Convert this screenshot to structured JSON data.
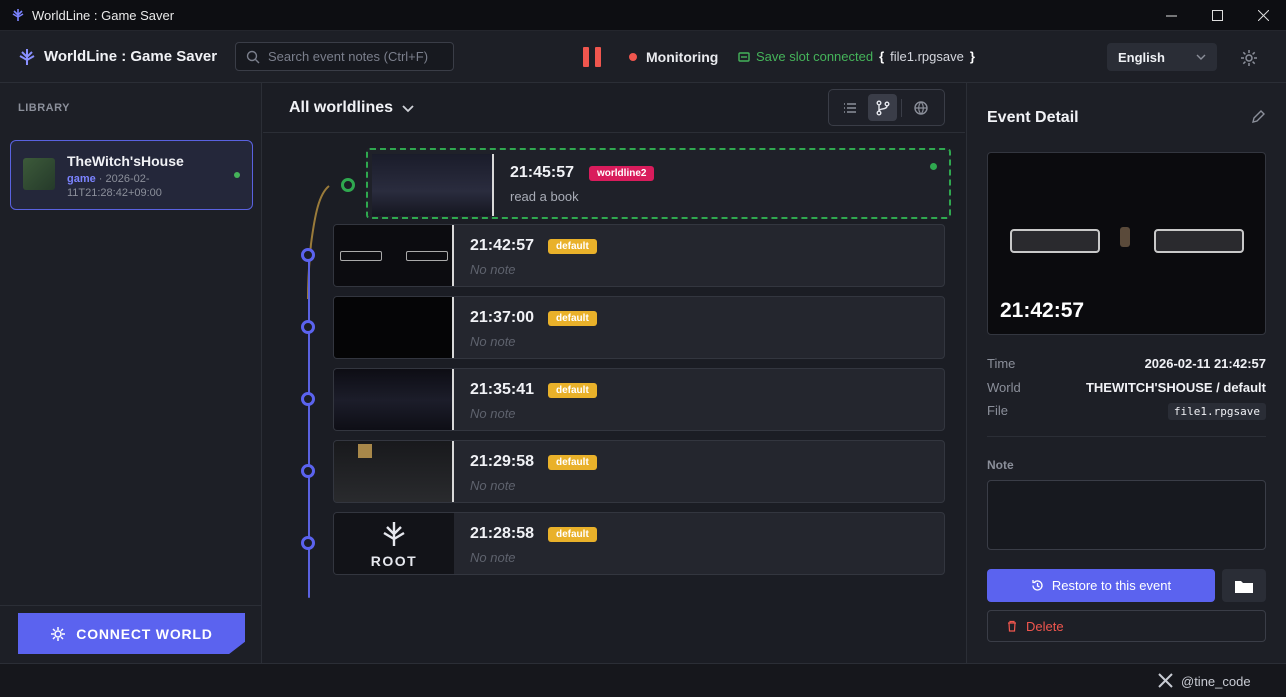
{
  "window": {
    "title": "WorldLine : Game Saver"
  },
  "header": {
    "brand": "WorldLine : Game Saver",
    "search_placeholder": "Search event notes (Ctrl+F)",
    "monitoring_label": "Monitoring",
    "slot_status": "Save slot connected",
    "slot_open": "{",
    "slot_file": "file1.rpgsave",
    "slot_close": "}",
    "language": "English"
  },
  "sidebar": {
    "title": "LIBRARY",
    "items": [
      {
        "name": "TheWitch'sHouse",
        "tag": "game",
        "date": " · 2026-02-11T21:28:42+09:00"
      }
    ],
    "connect_label": "CONNECT WORLD"
  },
  "main": {
    "worldline_selector": "All worldlines",
    "events": [
      {
        "time": "21:45:57",
        "badge": "worldline2",
        "note": "read a book"
      },
      {
        "time": "21:42:57",
        "badge": "default",
        "note": "No note"
      },
      {
        "time": "21:37:00",
        "badge": "default",
        "note": "No note"
      },
      {
        "time": "21:35:41",
        "badge": "default",
        "note": "No note"
      },
      {
        "time": "21:29:58",
        "badge": "default",
        "note": "No note"
      },
      {
        "time": "21:28:58",
        "badge": "default",
        "note": "No note",
        "thumb_label": "ROOT"
      }
    ]
  },
  "detail": {
    "title": "Event Detail",
    "preview_time": "21:42:57",
    "time_label": "Time",
    "time_value": "2026-02-11 21:42:57",
    "world_label": "World",
    "world_value": "THEWITCH'SHOUSE / default",
    "file_label": "File",
    "file_value": "file1.rpgsave",
    "note_label": "Note",
    "restore_label": "Restore to this event",
    "delete_label": "Delete"
  },
  "footer": {
    "handle": "@tine_code"
  },
  "colors": {
    "accent": "#5b63ef",
    "selected": "#2fa84f",
    "danger": "#f0564e",
    "badge_default": "#e9b12a",
    "badge_worldline2": "#d91c5c"
  }
}
